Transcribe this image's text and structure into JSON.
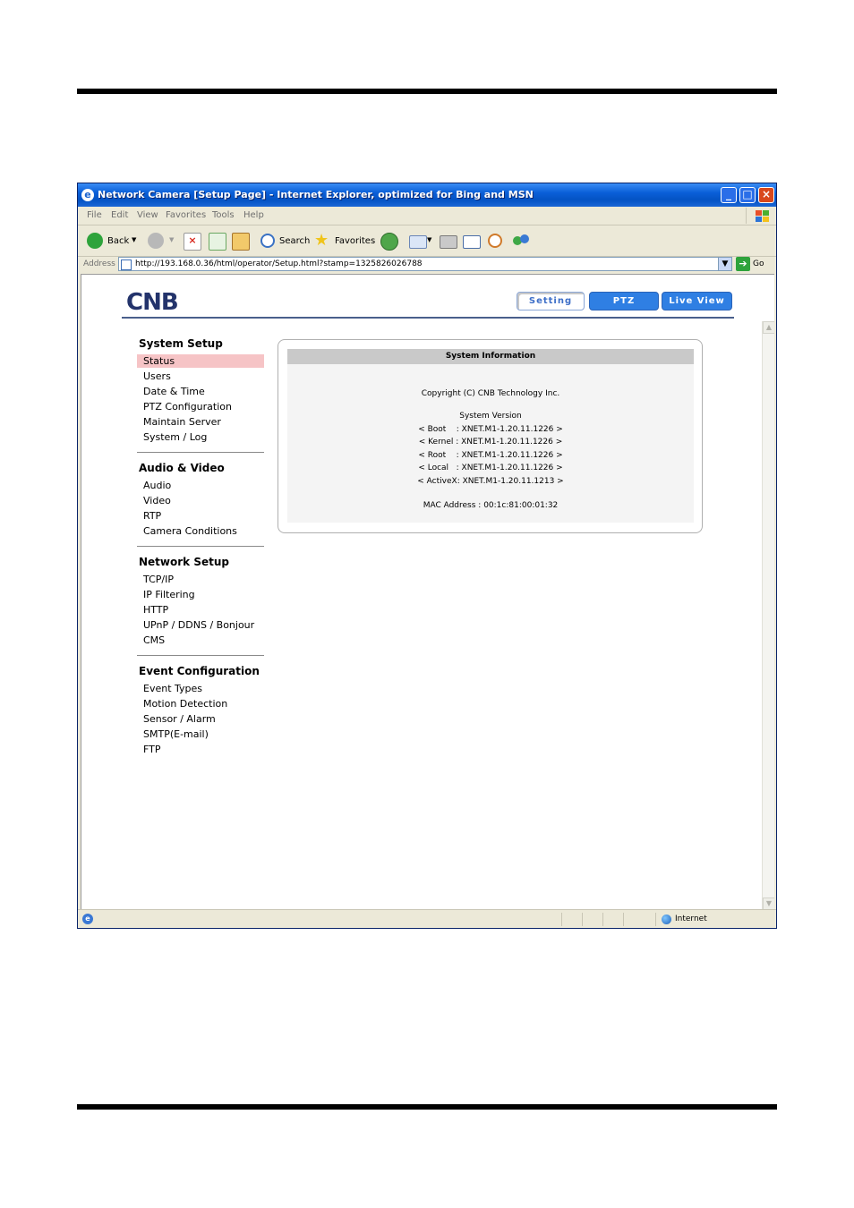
{
  "window": {
    "title": "Network Camera [Setup Page] - Internet Explorer, optimized for Bing and MSN",
    "minimize": "_",
    "maximize": "□",
    "close": "×"
  },
  "menu": [
    "File",
    "Edit",
    "View",
    "Favorites",
    "Tools",
    "Help"
  ],
  "toolbar": {
    "back": "Back",
    "search": "Search",
    "favorites": "Favorites"
  },
  "address": {
    "label": "Address",
    "url": "http://193.168.0.36/html/operator/Setup.html?stamp=1325826026788",
    "go": "Go"
  },
  "page": {
    "logo": "CNB",
    "buttons": {
      "setting": "Setting",
      "ptz": "PTZ",
      "live_view": "Live View"
    },
    "nav": [
      {
        "heading": "System Setup",
        "items": [
          "Status",
          "Users",
          "Date & Time",
          "PTZ Configuration",
          "Maintain Server",
          "System / Log"
        ]
      },
      {
        "heading": "Audio & Video",
        "items": [
          "Audio",
          "Video",
          "RTP",
          "Camera Conditions"
        ]
      },
      {
        "heading": "Network Setup",
        "items": [
          "TCP/IP",
          "IP Filtering",
          "HTTP",
          "UPnP / DDNS / Bonjour",
          "CMS"
        ]
      },
      {
        "heading": "Event Configuration",
        "items": [
          "Event Types",
          "Motion Detection",
          "Sensor / Alarm",
          "SMTP(E-mail)",
          "FTP"
        ]
      }
    ],
    "active_nav": "Status",
    "system_info": {
      "title": "System Information",
      "copyright": "Copyright (C) CNB Technology Inc.",
      "version_heading": "System Version",
      "versions": [
        "< Boot    : XNET.M1-1.20.11.1226 >",
        "< Kernel : XNET.M1-1.20.11.1226 >",
        "< Root    : XNET.M1-1.20.11.1226 >",
        "< Local   : XNET.M1-1.20.11.1226 >",
        "< ActiveX: XNET.M1-1.20.11.1213 >"
      ],
      "mac": "MAC Address : 00:1c:81:00:01:32"
    }
  },
  "status": {
    "zone": "Internet"
  },
  "colors": {
    "titlebar": "#0453c4",
    "brand": "#23336b",
    "active_nav_bg": "#f6c4c6",
    "button_blue": "#2f7fe3"
  }
}
